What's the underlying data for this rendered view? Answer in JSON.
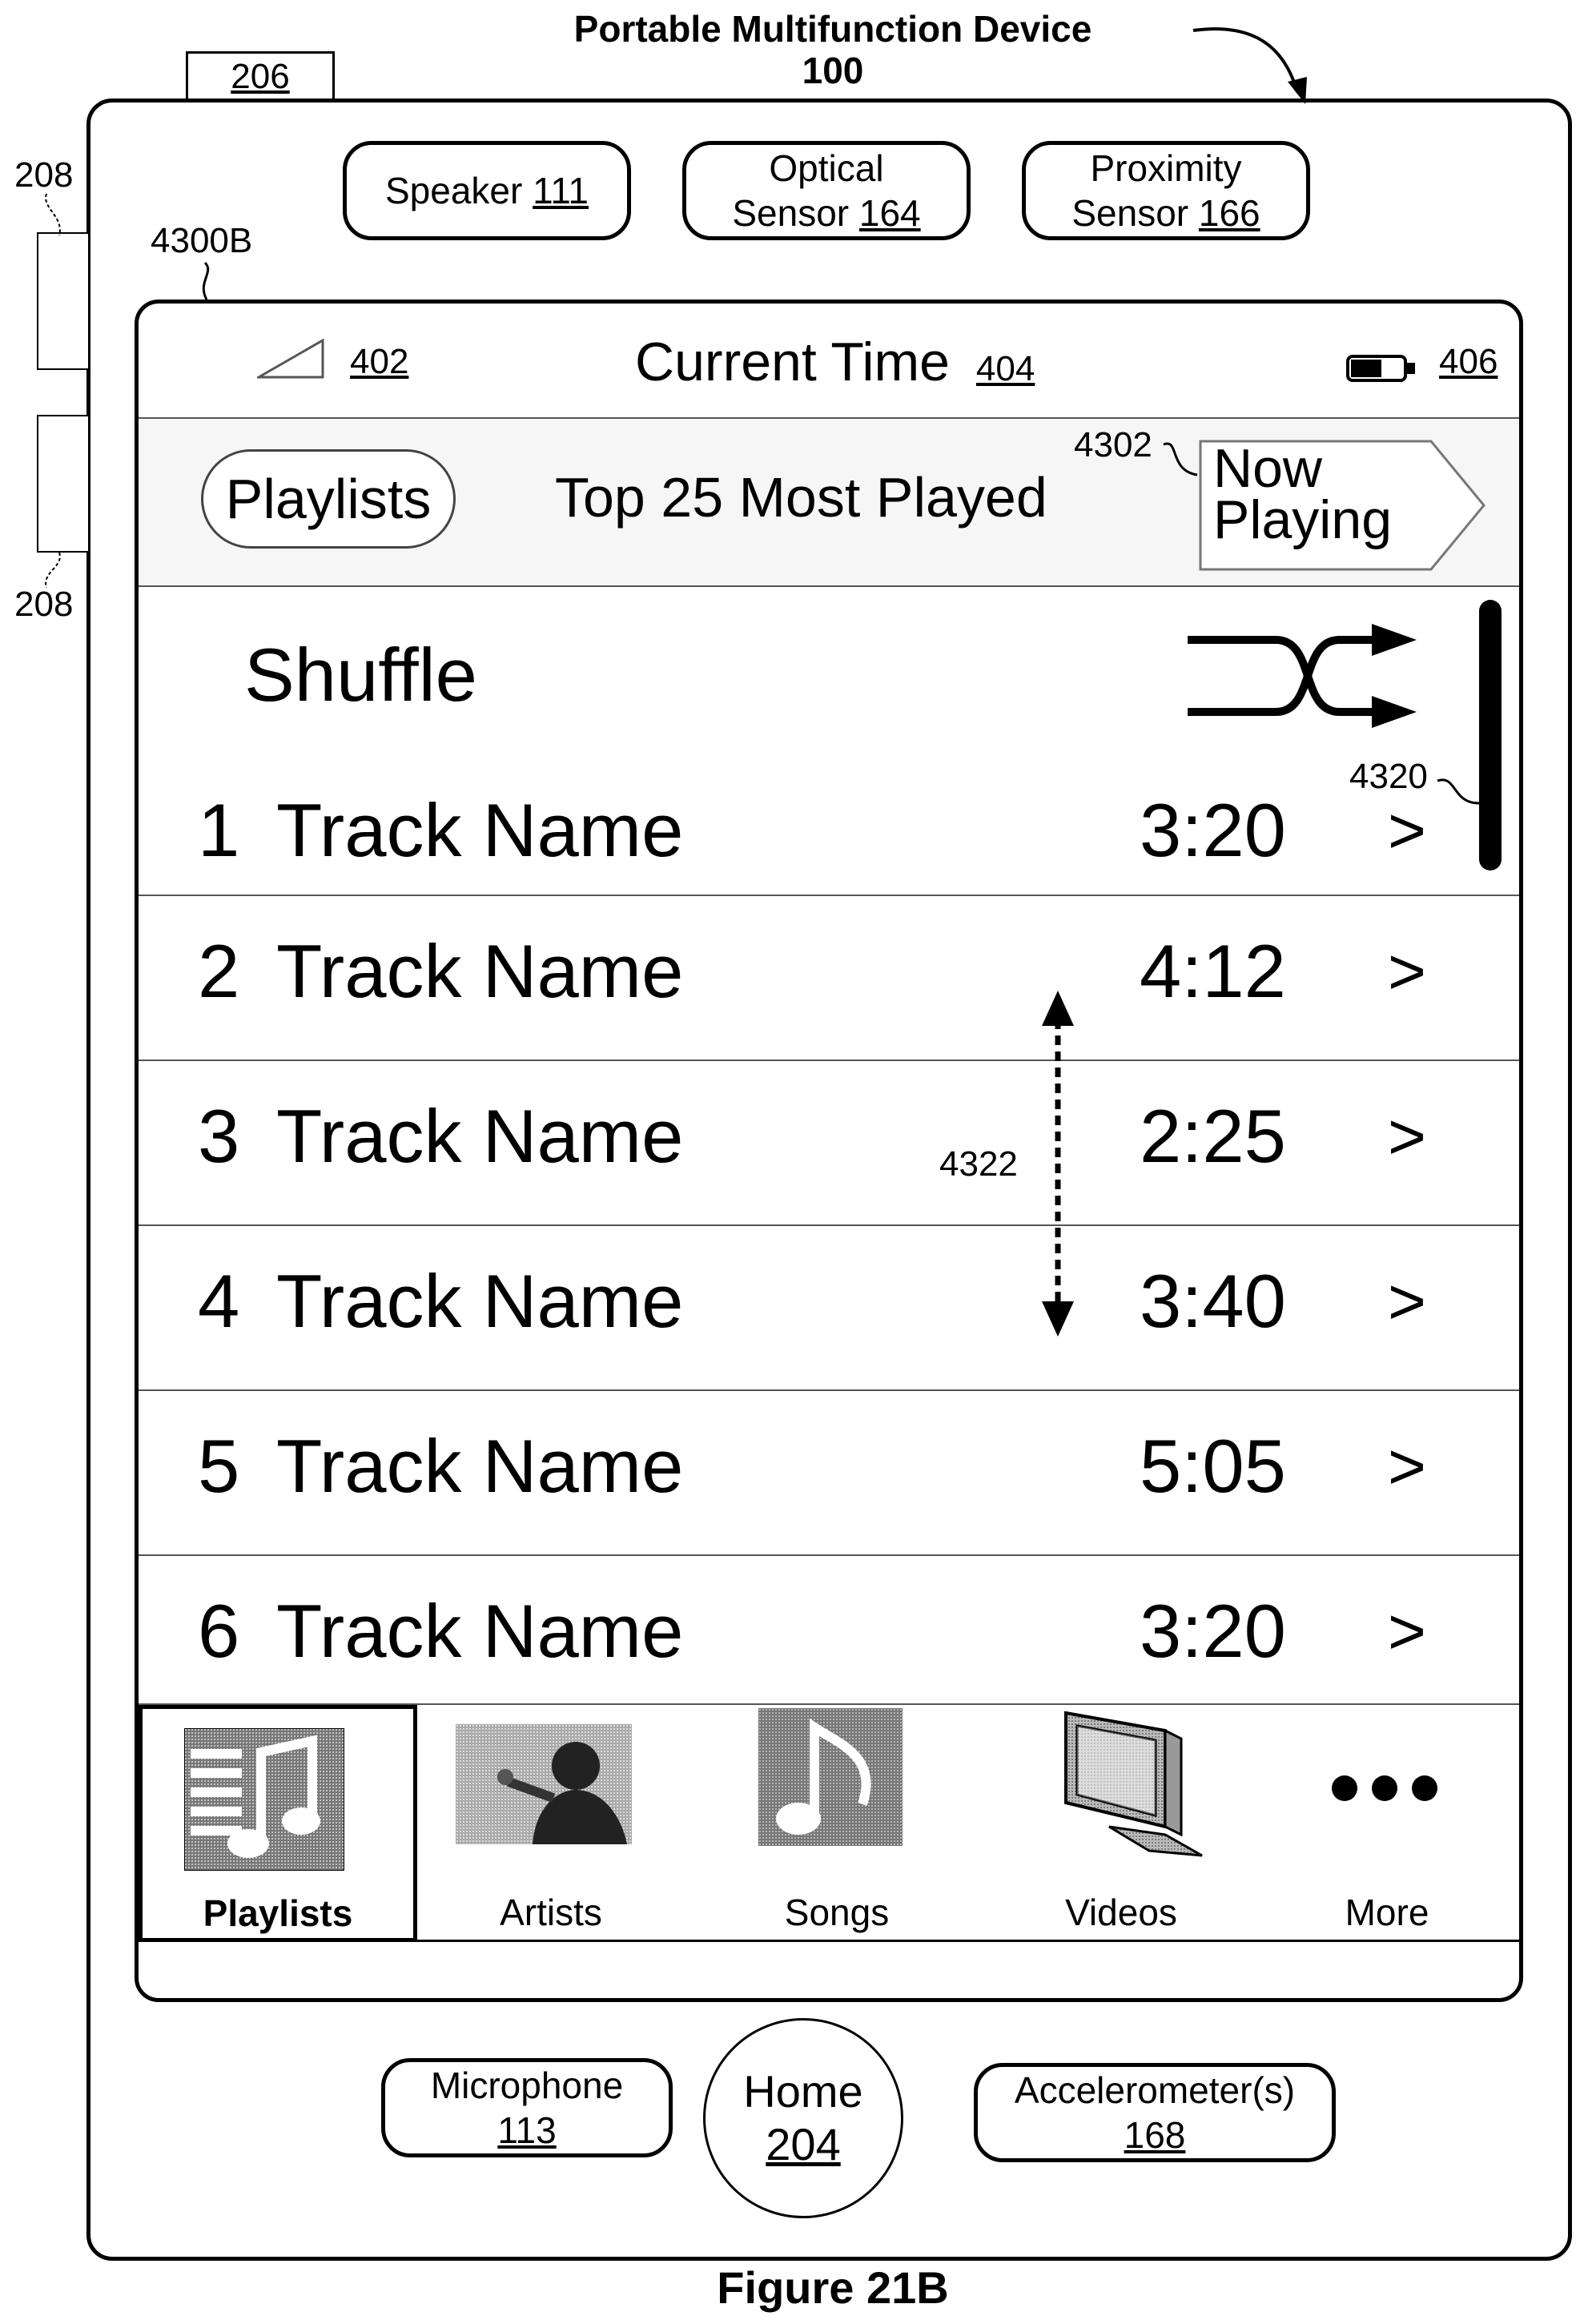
{
  "header": {
    "device_title": "Portable Multifunction Device",
    "device_number": "100",
    "ref_206": "206",
    "ref_208_top": "208",
    "ref_208_bottom": "208",
    "ref_4300b": "4300B"
  },
  "hardware_top": {
    "speaker_label": "Speaker",
    "speaker_ref": "111",
    "optical_label": "Optical",
    "optical_label_2": "Sensor",
    "optical_ref": "164",
    "proximity_label": "Proximity",
    "proximity_label_2": "Sensor",
    "proximity_ref": "166"
  },
  "status_bar": {
    "signal_ref": "402",
    "time_label": "Current Time",
    "time_ref": "404",
    "battery_ref": "406"
  },
  "nav_bar": {
    "back_button": "Playlists",
    "title": "Top 25 Most Played",
    "now_playing_line1": "Now",
    "now_playing_line2": "Playing",
    "now_playing_ref": "4302"
  },
  "list": {
    "shuffle_label": "Shuffle",
    "scrollbar_ref": "4320",
    "gesture_ref": "4322",
    "tracks": [
      {
        "num": "1",
        "name": "Track Name",
        "time": "3:20",
        "chevron": ">"
      },
      {
        "num": "2",
        "name": "Track Name",
        "time": "4:12",
        "chevron": ">"
      },
      {
        "num": "3",
        "name": "Track Name",
        "time": "2:25",
        "chevron": ">"
      },
      {
        "num": "4",
        "name": "Track Name",
        "time": "3:40",
        "chevron": ">"
      },
      {
        "num": "5",
        "name": "Track Name",
        "time": "5:05",
        "chevron": ">"
      },
      {
        "num": "6",
        "name": "Track Name",
        "time": "3:20",
        "chevron": ">"
      }
    ]
  },
  "tab_bar": {
    "tabs": [
      {
        "label": "Playlists",
        "icon": "playlists-icon",
        "selected": true
      },
      {
        "label": "Artists",
        "icon": "artist-icon",
        "selected": false
      },
      {
        "label": "Songs",
        "icon": "music-note-icon",
        "selected": false
      },
      {
        "label": "Videos",
        "icon": "tv-icon",
        "selected": false
      },
      {
        "label": "More",
        "icon": "more-dots-icon",
        "selected": false
      }
    ]
  },
  "hardware_bottom": {
    "microphone_label": "Microphone",
    "microphone_ref": "113",
    "home_label": "Home",
    "home_ref": "204",
    "accelerometer_label": "Accelerometer(s)",
    "accelerometer_ref": "168"
  },
  "caption": "Figure 21B"
}
